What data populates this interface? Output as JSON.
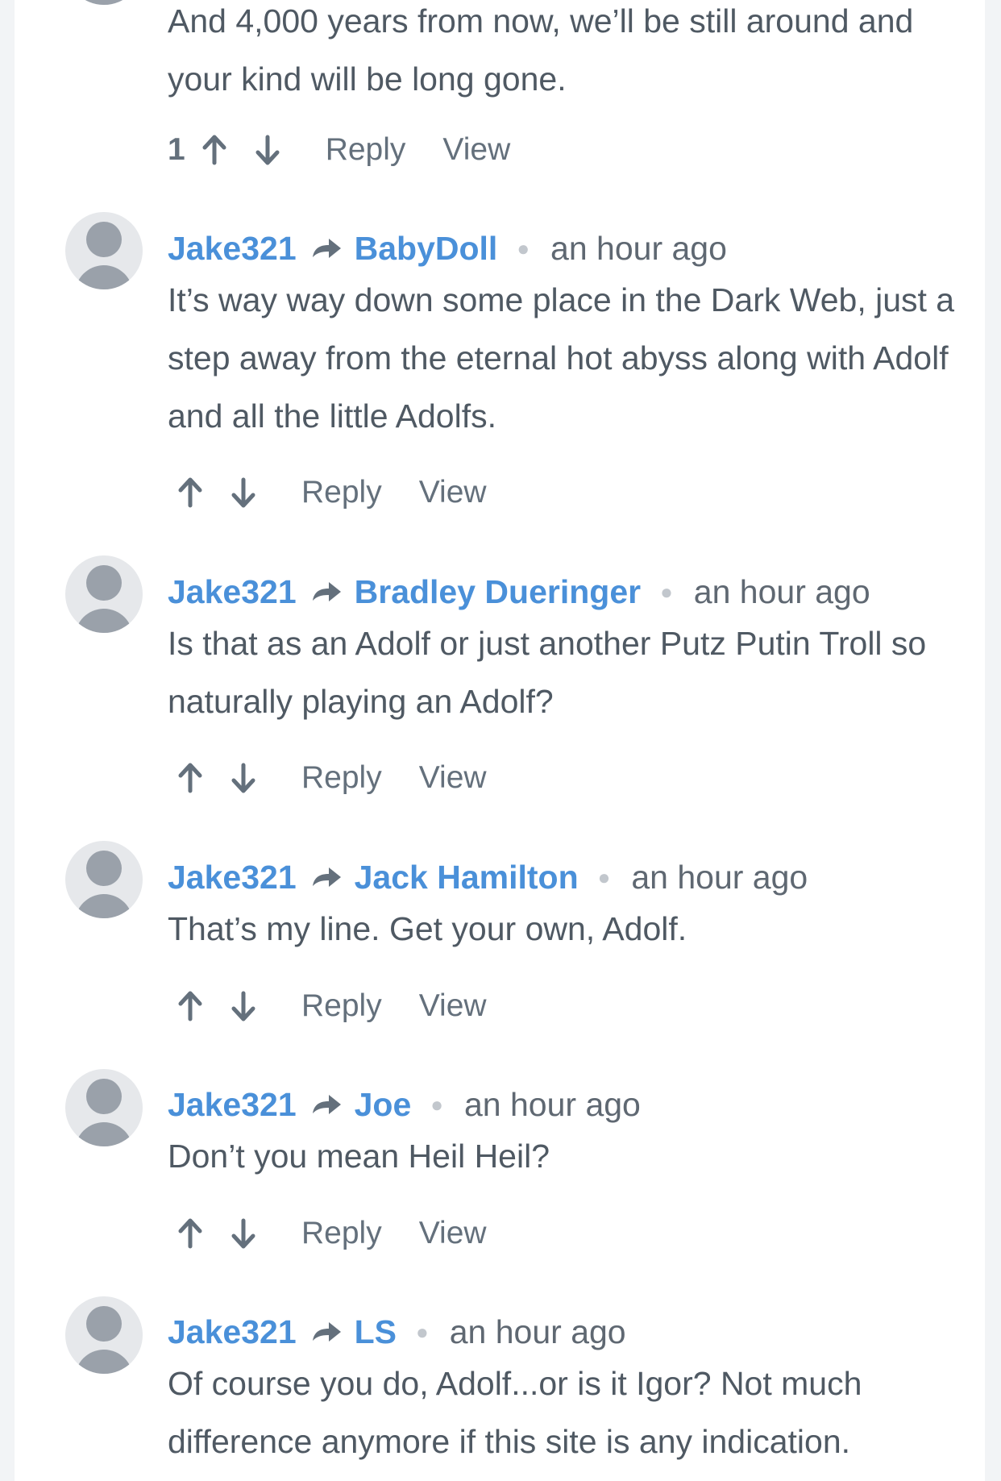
{
  "colors": {
    "link": "#4a90d9",
    "text": "#4f5963",
    "muted": "#5f6872",
    "avatar": "#9aa1aa"
  },
  "top_comment": {
    "body": "And 4,000 years from now, we’ll be still around and your kind will be long gone.",
    "vote_count": "1",
    "reply_label": "Reply",
    "view_label": "View"
  },
  "comments": [
    {
      "author": "Jake321",
      "recipient": "BabyDoll",
      "time": "an hour ago",
      "body": "It’s way way down some place in the Dark Web, just a step away from the eternal hot abyss along with Adolf and all the little Adolfs.",
      "reply_label": "Reply",
      "view_label": "View"
    },
    {
      "author": "Jake321",
      "recipient": "Bradley Dueringer",
      "time": "an hour ago",
      "body": "Is that as an Adolf or just another Putz Putin Troll so naturally playing an Adolf?",
      "reply_label": "Reply",
      "view_label": "View"
    },
    {
      "author": "Jake321",
      "recipient": "Jack Hamilton",
      "time": "an hour ago",
      "body": "That’s my line. Get your own, Adolf.",
      "reply_label": "Reply",
      "view_label": "View"
    },
    {
      "author": "Jake321",
      "recipient": "Joe",
      "time": "an hour ago",
      "body": "Don’t you mean Heil Heil?",
      "reply_label": "Reply",
      "view_label": "View"
    },
    {
      "author": "Jake321",
      "recipient": "LS",
      "time": "an hour ago",
      "body": "Of course you do, Adolf...or is it Igor? Not much difference anymore if this site is any indication."
    }
  ]
}
